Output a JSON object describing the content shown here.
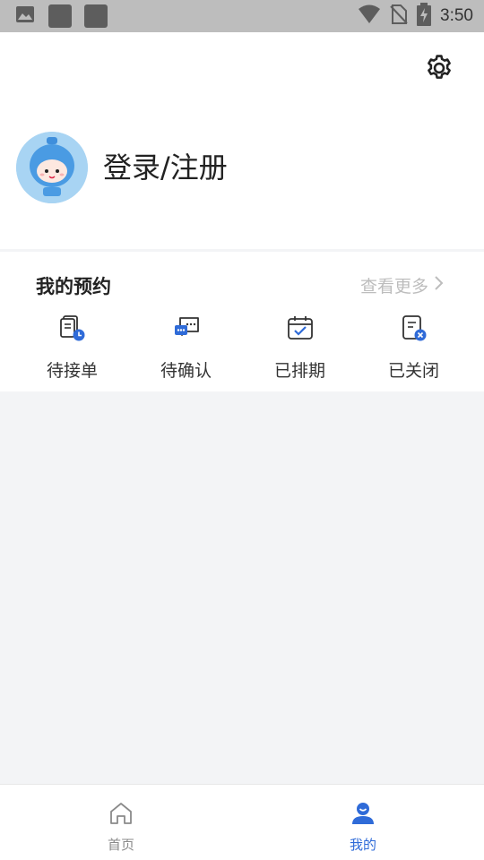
{
  "status_bar": {
    "time": "3:50",
    "icons": [
      "image-icon",
      "app-square-icon",
      "app-square-icon",
      "wifi-icon",
      "no-sim-icon",
      "battery-charging-icon"
    ]
  },
  "header": {
    "login_label": "登录/注册",
    "settings_icon": "gear-icon"
  },
  "appointments": {
    "title": "我的预约",
    "more_label": "查看更多",
    "items": [
      {
        "label": "待接单",
        "icon": "pending-order-icon"
      },
      {
        "label": "待确认",
        "icon": "chat-confirm-icon"
      },
      {
        "label": "已排期",
        "icon": "calendar-check-icon"
      },
      {
        "label": "已关闭",
        "icon": "document-closed-icon"
      }
    ]
  },
  "bottom_nav": {
    "items": [
      {
        "label": "首页",
        "icon": "home-icon",
        "active": false
      },
      {
        "label": "我的",
        "icon": "user-icon",
        "active": true
      }
    ]
  },
  "colors": {
    "accent": "#2f6bd8",
    "background": "#f3f4f6",
    "status_bar": "#bdbdbd"
  }
}
